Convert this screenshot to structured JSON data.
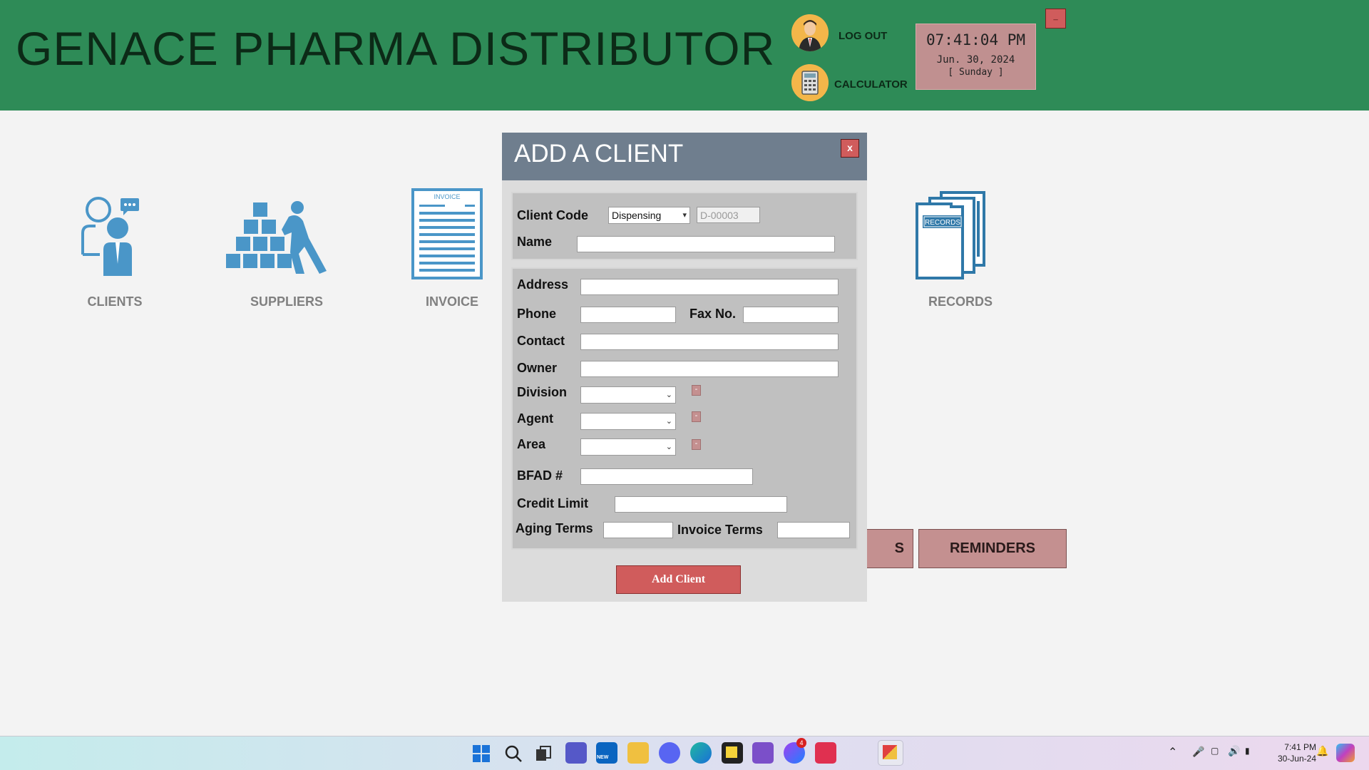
{
  "header": {
    "title": "GENACE PHARMA DISTRIBUTOR",
    "logout_label": "LOG OUT",
    "calculator_label": "CALCULATOR",
    "minimize_label": "_"
  },
  "clock": {
    "time": "07:41:04 PM",
    "date": "Jun. 30, 2024",
    "day": "[ Sunday ]"
  },
  "tiles": {
    "clients": "CLIENTS",
    "suppliers": "SUPPLIERS",
    "invoice": "INVOICE",
    "invoice_doc_text": "INVOICE",
    "records": "RECORDS",
    "records_doc_text": "RECORDS"
  },
  "buttons": {
    "partial_left": "S",
    "reminders": "REMINDERS"
  },
  "dialog": {
    "title": "ADD A CLIENT",
    "close_label": "x",
    "client_code_label": "Client Code",
    "client_type": "Dispensing",
    "client_code_value": "D-00003",
    "name_label": "Name",
    "name_value": "",
    "address_label": "Address",
    "address_value": "",
    "phone_label": "Phone",
    "phone_value": "",
    "fax_label": "Fax No.",
    "fax_value": "",
    "contact_label": "Contact",
    "contact_value": "",
    "owner_label": "Owner",
    "owner_value": "",
    "division_label": "Division",
    "agent_label": "Agent",
    "area_label": "Area",
    "mini_button_label": "-",
    "bfad_label": "BFAD #",
    "bfad_value": "",
    "credit_limit_label": "Credit Limit",
    "credit_limit_value": "",
    "aging_terms_label": "Aging Terms",
    "aging_terms_value": "",
    "invoice_terms_label": "Invoice Terms",
    "invoice_terms_value": "",
    "add_button": "Add Client"
  },
  "taskbar": {
    "time": "7:41 PM",
    "date": "30-Jun-24",
    "messenger_badge": "4",
    "outlook_badge": "NEW"
  },
  "colors": {
    "header_bg": "#2e8b57",
    "dialog_title_bg": "#6f7e8e",
    "accent_red": "#d05c5c",
    "tile_blue": "#4a96c8",
    "button_rose": "#c49090"
  }
}
